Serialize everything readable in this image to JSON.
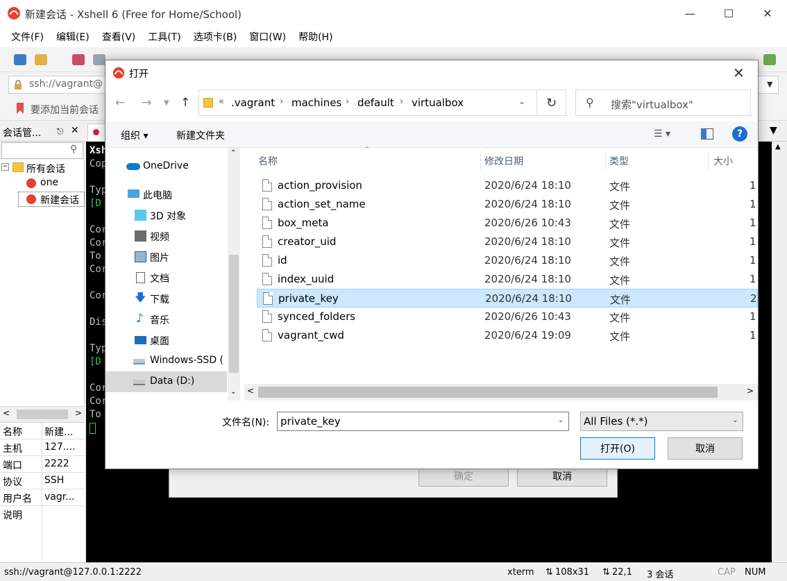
{
  "xshell": {
    "title": "新建会话 - Xshell 6 (Free for Home/School)",
    "menu": [
      "文件(F)",
      "编辑(E)",
      "查看(V)",
      "工具(T)",
      "选项卡(B)",
      "窗口(W)",
      "帮助(H)"
    ],
    "address": "ssh://vagrant@",
    "hint": "要添加当前会话",
    "session_panel_title": "会话管...",
    "tree": {
      "root": "所有会话",
      "items": [
        "one",
        "新建会话"
      ]
    },
    "tab_label": "",
    "terminal_lines": [
      "Xsh",
      "Cop",
      "",
      "Typ",
      "[D",
      "",
      "Cor",
      "Cor",
      "To",
      "Cor",
      "",
      "Cor",
      "",
      "Dis",
      "",
      "Typ",
      "[D",
      "",
      "Cor",
      "Cor",
      "To"
    ],
    "properties": [
      {
        "key": "名称",
        "value": "新建..."
      },
      {
        "key": "主机",
        "value": "127...."
      },
      {
        "key": "端口",
        "value": "2222"
      },
      {
        "key": "协议",
        "value": "SSH"
      },
      {
        "key": "用户名",
        "value": "vagr..."
      },
      {
        "key": "说明",
        "value": ""
      }
    ],
    "status": {
      "connection": "ssh://vagrant@127.0.0.1:2222",
      "term": "xterm",
      "size": "108x31",
      "pos": "22,1",
      "sessions": "3 会话",
      "cap": "CAP",
      "num": "NUM"
    },
    "behind_dialog": {
      "ok": "确定",
      "cancel": "取消"
    }
  },
  "dialog": {
    "title": "打开",
    "breadcrumb": [
      ".vagrant",
      "machines",
      "default",
      "virtualbox"
    ],
    "breadcrumb_prefix": "«",
    "search_placeholder": "搜索\"virtualbox\"",
    "organize": "组织 ▾",
    "new_folder": "新建文件夹",
    "nav_items": [
      {
        "label": "OneDrive",
        "icon": "onedrive-icon"
      },
      {
        "label": "此电脑",
        "icon": "computer-icon"
      },
      {
        "label": "3D 对象",
        "icon": "3d-objects-icon"
      },
      {
        "label": "视频",
        "icon": "video-icon"
      },
      {
        "label": "图片",
        "icon": "pictures-icon"
      },
      {
        "label": "文档",
        "icon": "documents-icon"
      },
      {
        "label": "下载",
        "icon": "download-icon"
      },
      {
        "label": "音乐",
        "icon": "music-icon"
      },
      {
        "label": "桌面",
        "icon": "desktop-icon"
      },
      {
        "label": "Windows-SSD (",
        "icon": "drive-icon"
      },
      {
        "label": "Data (D:)",
        "icon": "drive-icon"
      }
    ],
    "columns": {
      "name": "名称",
      "modified": "修改日期",
      "type": "类型",
      "size": "大小"
    },
    "files": [
      {
        "name": "action_provision",
        "modified": "2020/6/24 18:10",
        "type": "文件",
        "size": "1"
      },
      {
        "name": "action_set_name",
        "modified": "2020/6/24 18:10",
        "type": "文件",
        "size": "1"
      },
      {
        "name": "box_meta",
        "modified": "2020/6/26 10:43",
        "type": "文件",
        "size": "1"
      },
      {
        "name": "creator_uid",
        "modified": "2020/6/24 18:10",
        "type": "文件",
        "size": "1"
      },
      {
        "name": "id",
        "modified": "2020/6/24 18:10",
        "type": "文件",
        "size": "1"
      },
      {
        "name": "index_uuid",
        "modified": "2020/6/24 18:10",
        "type": "文件",
        "size": "1"
      },
      {
        "name": "private_key",
        "modified": "2020/6/24 18:10",
        "type": "文件",
        "size": "2"
      },
      {
        "name": "synced_folders",
        "modified": "2020/6/26 10:43",
        "type": "文件",
        "size": "1"
      },
      {
        "name": "vagrant_cwd",
        "modified": "2020/6/24 19:09",
        "type": "文件",
        "size": "1"
      }
    ],
    "selected_file_index": 6,
    "filename_label": "文件名(N):",
    "filename_value": "private_key",
    "filetype_value": "All Files (*.*)",
    "open_button": "打开(O)",
    "cancel_button": "取消"
  }
}
